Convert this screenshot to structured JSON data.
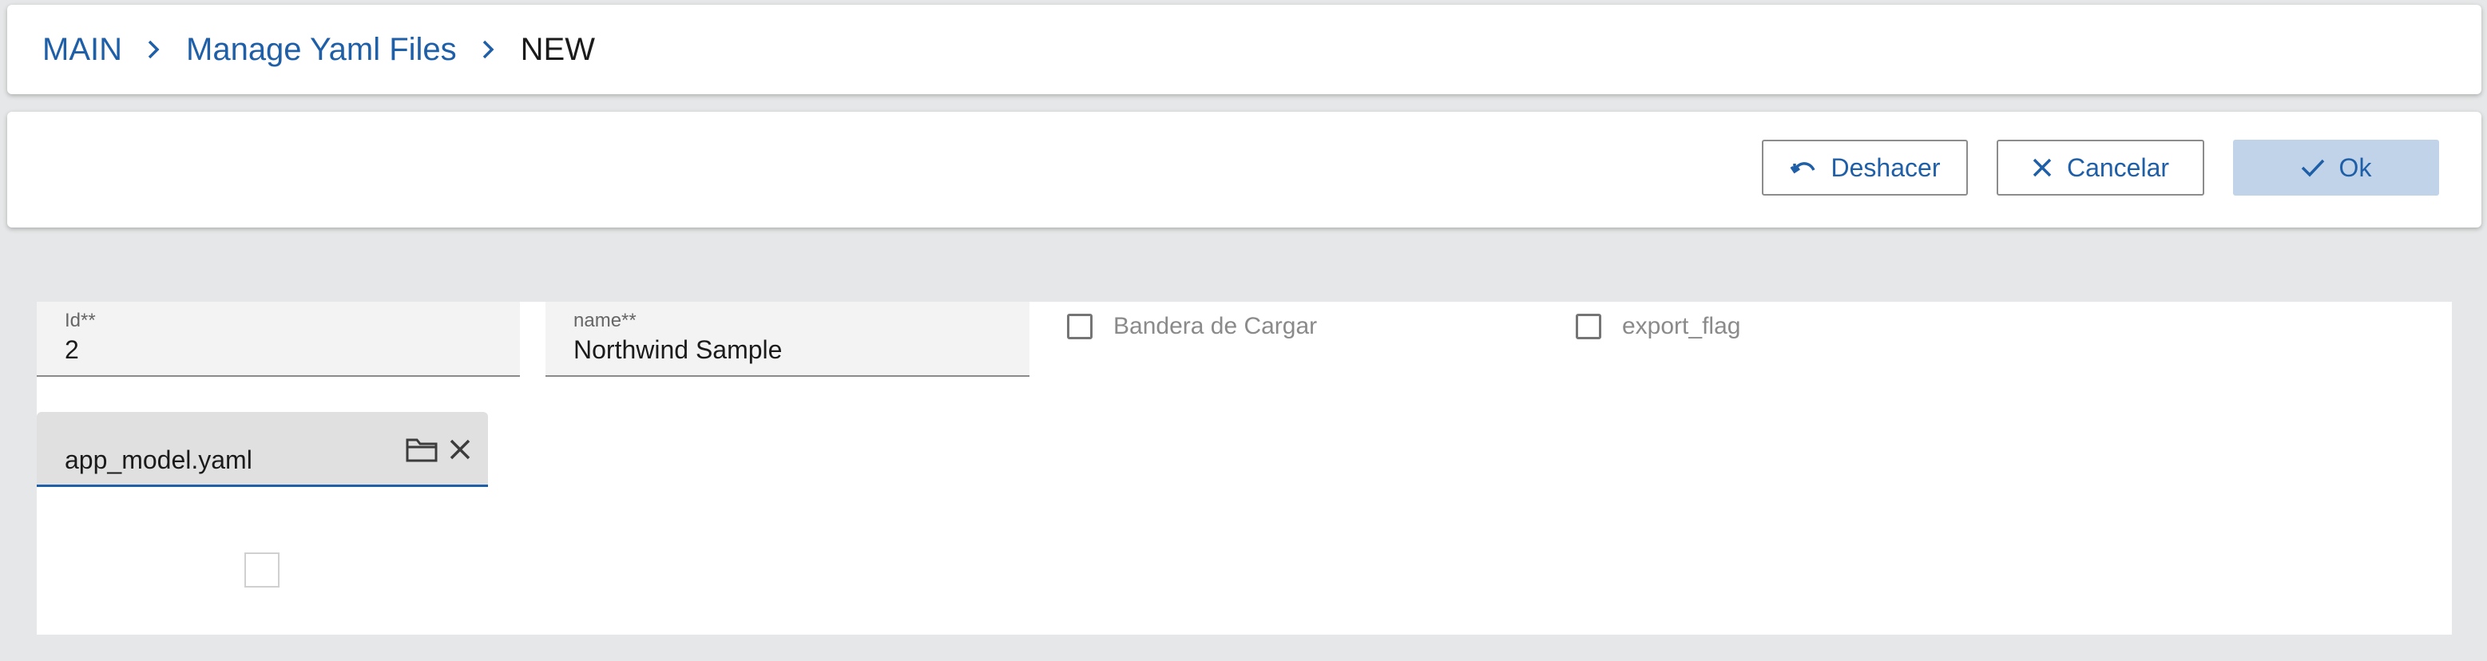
{
  "breadcrumb": {
    "items": [
      "MAIN",
      "Manage Yaml Files"
    ],
    "current": "NEW"
  },
  "toolbar": {
    "undo_label": "Deshacer",
    "cancel_label": "Cancelar",
    "ok_label": "Ok"
  },
  "form": {
    "id": {
      "label": "Id**",
      "value": "2"
    },
    "name": {
      "label": "name**",
      "value": "Northwind Sample"
    },
    "load_flag": {
      "label": "Bandera de Cargar",
      "checked": false
    },
    "export_flag": {
      "label": "export_flag",
      "checked": false
    },
    "file": {
      "value": "app_model.yaml"
    }
  },
  "colors": {
    "accent": "#1f5fa8",
    "background": "#e6e7e8",
    "ok_button_bg": "#c0d3e8"
  },
  "icons": {
    "breadcrumb_separator": "chevron-right-icon",
    "undo": "undo-icon",
    "cancel": "close-icon",
    "ok": "check-icon",
    "file_browse": "folder-icon",
    "file_clear": "close-icon"
  }
}
